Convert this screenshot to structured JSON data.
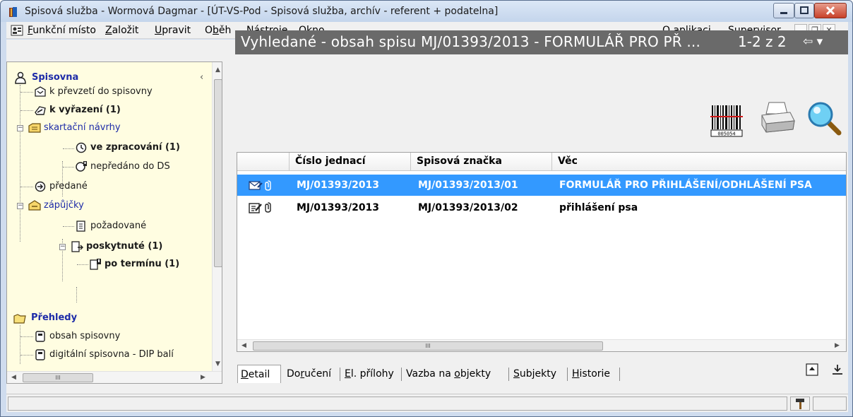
{
  "window": {
    "title": "Spisová služba - Wormová Dagmar - [ÚT-VS-Pod - Spisová služba, archív - referent + podatelna]"
  },
  "menubar": {
    "items": [
      {
        "label": "Funkční místo",
        "accel": "F"
      },
      {
        "label": "Založit",
        "accel": "Z"
      },
      {
        "label": "Upravit",
        "accel": "U"
      },
      {
        "label": "Oběh",
        "accel": "b"
      },
      {
        "label": "Nástroje",
        "accel": "N"
      },
      {
        "label": "Okno",
        "accel": "k"
      }
    ],
    "o_aplikaci": "O aplikaci",
    "supervisor": "Supervisor"
  },
  "tree": {
    "spisovna": {
      "header": "Spisovna",
      "items": [
        {
          "label": "k převzetí do spisovny",
          "bold": false,
          "icon": "inbox-icon"
        },
        {
          "label": "k vyřazení (1)",
          "bold": true,
          "icon": "discard-icon"
        },
        {
          "label": "skartační návrhy",
          "bold": false,
          "blue": true,
          "icon": "shred-proposal-icon"
        },
        {
          "label": "ve zpracování (1)",
          "bold": true,
          "icon": "processing-icon"
        },
        {
          "label": "nepředáno do DS",
          "bold": false,
          "icon": "not-sent-icon"
        },
        {
          "label": "předané",
          "bold": false,
          "icon": "handed-over-icon"
        },
        {
          "label": "zápůjčky",
          "bold": false,
          "blue": true,
          "icon": "loans-icon"
        },
        {
          "label": "požadované",
          "bold": false,
          "icon": "requested-icon"
        },
        {
          "label": "poskytnuté (1)",
          "bold": true,
          "icon": "provided-icon"
        },
        {
          "label": "po termínu (1)",
          "bold": true,
          "icon": "overdue-icon"
        }
      ]
    },
    "prehledy": {
      "header": "Přehledy",
      "items": [
        {
          "label": "obsah spisovny",
          "icon": "archive-content-icon"
        },
        {
          "label": "digitální spisovna - DIP balí",
          "icon": "digital-archive-icon"
        }
      ]
    }
  },
  "results": {
    "title": "Vyhledané - obsah spisu MJ/01393/2013 - FORMULÁŘ PRO PŘ ...",
    "count": "1-2 z 2"
  },
  "grid": {
    "columns": [
      "Číslo jednací",
      "Spisová značka",
      "Věc"
    ],
    "rows": [
      {
        "cislo": "MJ/01393/2013",
        "znacka": "MJ/01393/2013/01",
        "vec": "FORMULÁŘ PRO PŘIHLÁŠENÍ/ODHLÁŠENÍ PSA",
        "selected": true,
        "icon": "email-icon"
      },
      {
        "cislo": "MJ/01393/2013",
        "znacka": "MJ/01393/2013/02",
        "vec": "přihlášení psa",
        "selected": false,
        "icon": "edit-document-icon"
      }
    ],
    "scroll_grip": "III"
  },
  "tabs": [
    {
      "label": "Detail",
      "accel": "D",
      "active": true
    },
    {
      "label": "Doručení",
      "accel": "r"
    },
    {
      "label": "El. přílohy",
      "accel": "E"
    },
    {
      "label": "Vazba na objekty",
      "accel": "o"
    },
    {
      "label": "Subjekty",
      "accel": "S"
    },
    {
      "label": "Historie",
      "accel": "H"
    }
  ],
  "tree_scroll_grip": "III",
  "barcode_label": "005054",
  "colors": {
    "selection": "#3399ff",
    "header_bg": "#6a6a6a",
    "tree_bg": "#fffde1",
    "tree_blue": "#1d2ba8"
  }
}
